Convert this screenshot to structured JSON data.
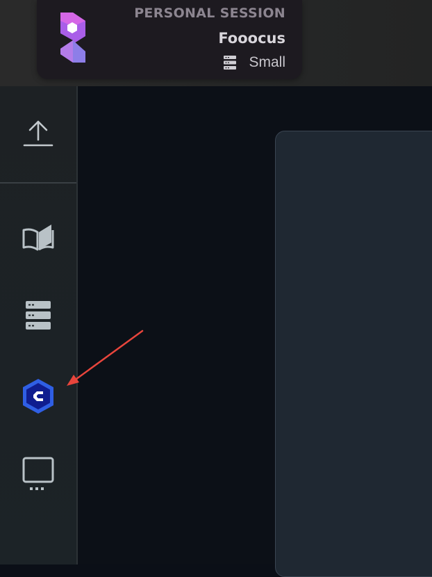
{
  "session": {
    "label": "PERSONAL SESSION",
    "name": "Fooocus",
    "size": "Small"
  },
  "sidebar": {
    "items": [
      {
        "name": "upload",
        "icon": "upload-icon"
      },
      {
        "name": "docs",
        "icon": "book-open-icon"
      },
      {
        "name": "server",
        "icon": "server-stack-icon"
      },
      {
        "name": "app",
        "icon": "c-hexagon-icon"
      },
      {
        "name": "display",
        "icon": "monitor-icon"
      }
    ]
  },
  "annotation": {
    "color": "#e8453c"
  }
}
